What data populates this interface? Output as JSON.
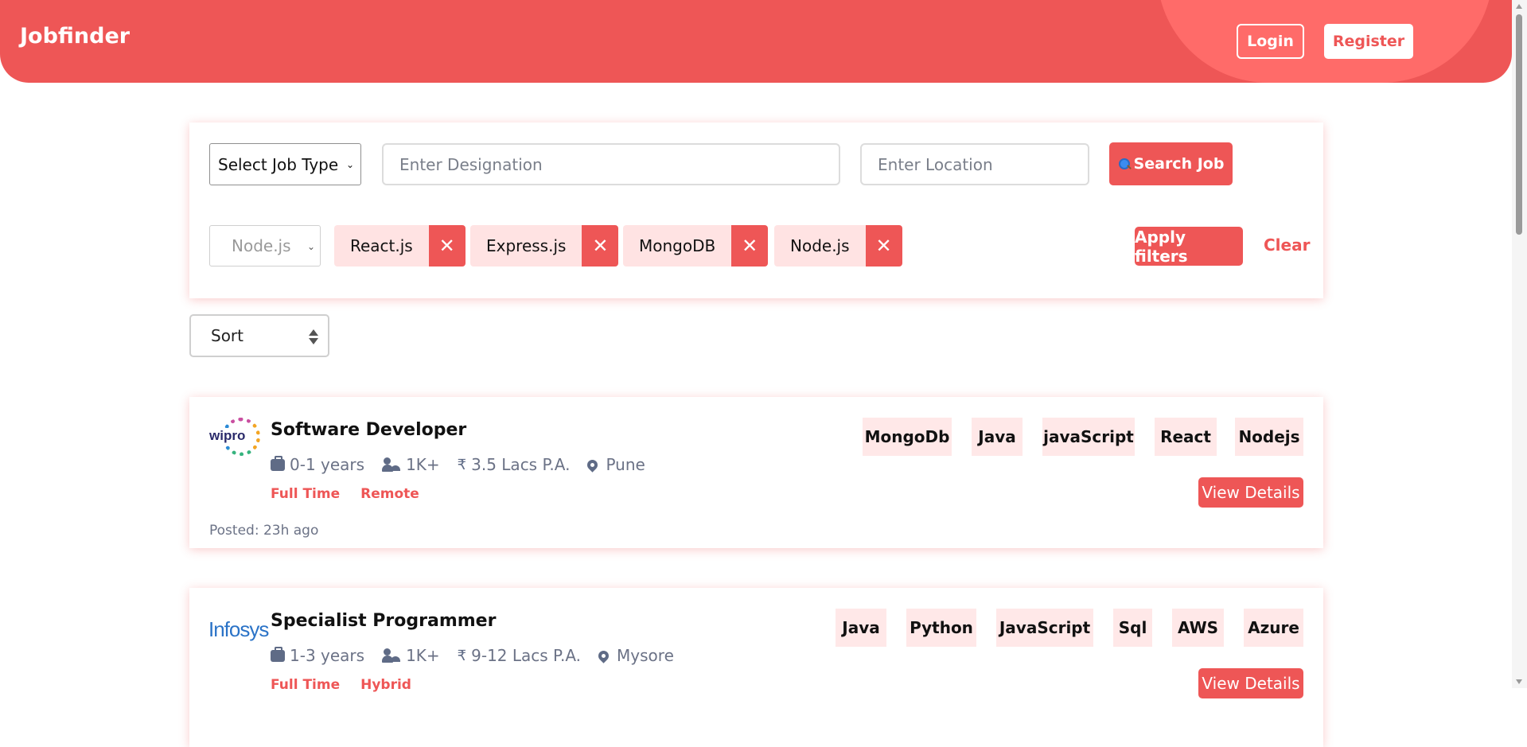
{
  "header": {
    "brand": "Jobfinder",
    "login_label": "Login",
    "register_label": "Register",
    "color": "#ee5656"
  },
  "search": {
    "job_type_select": "Select Job Type",
    "designation_placeholder": "Enter Designation",
    "location_placeholder": "Enter Location",
    "search_label": "Search Job",
    "search_icon": "magnifier-icon"
  },
  "filters": {
    "skill_select": "Node.js",
    "chips": [
      {
        "label": "React.js",
        "remove_icon": "close-icon"
      },
      {
        "label": "Express.js",
        "remove_icon": "close-icon"
      },
      {
        "label": "MongoDB",
        "remove_icon": "close-icon"
      },
      {
        "label": "Node.js",
        "remove_icon": "close-icon"
      }
    ],
    "apply_label": "Apply filters",
    "clear_label": "Clear"
  },
  "sort": {
    "label": "Sort"
  },
  "jobs": [
    {
      "company_logo_text": "wipro",
      "title": "Software Developer",
      "experience": "0-1 years",
      "applicants": "1K+",
      "salary": "3.5 Lacs P.A.",
      "location": "Pune",
      "job_type": "Full Time",
      "work_mode": "Remote",
      "posted": "Posted: 23h ago",
      "skills": [
        "MongoDb",
        "Java",
        "javaScript",
        "React",
        "Nodejs"
      ],
      "details_label": "View Details"
    },
    {
      "company_logo_text": "Infosys",
      "title": "Specialist Programmer",
      "experience": "1-3 years",
      "applicants": "1K+",
      "salary": "9-12 Lacs P.A.",
      "location": "Mysore",
      "job_type": "Full Time",
      "work_mode": "Hybrid",
      "skills": [
        "Java",
        "Python",
        "JavaScript",
        "Sql",
        "AWS",
        "Azure"
      ],
      "details_label": "View Details"
    }
  ]
}
